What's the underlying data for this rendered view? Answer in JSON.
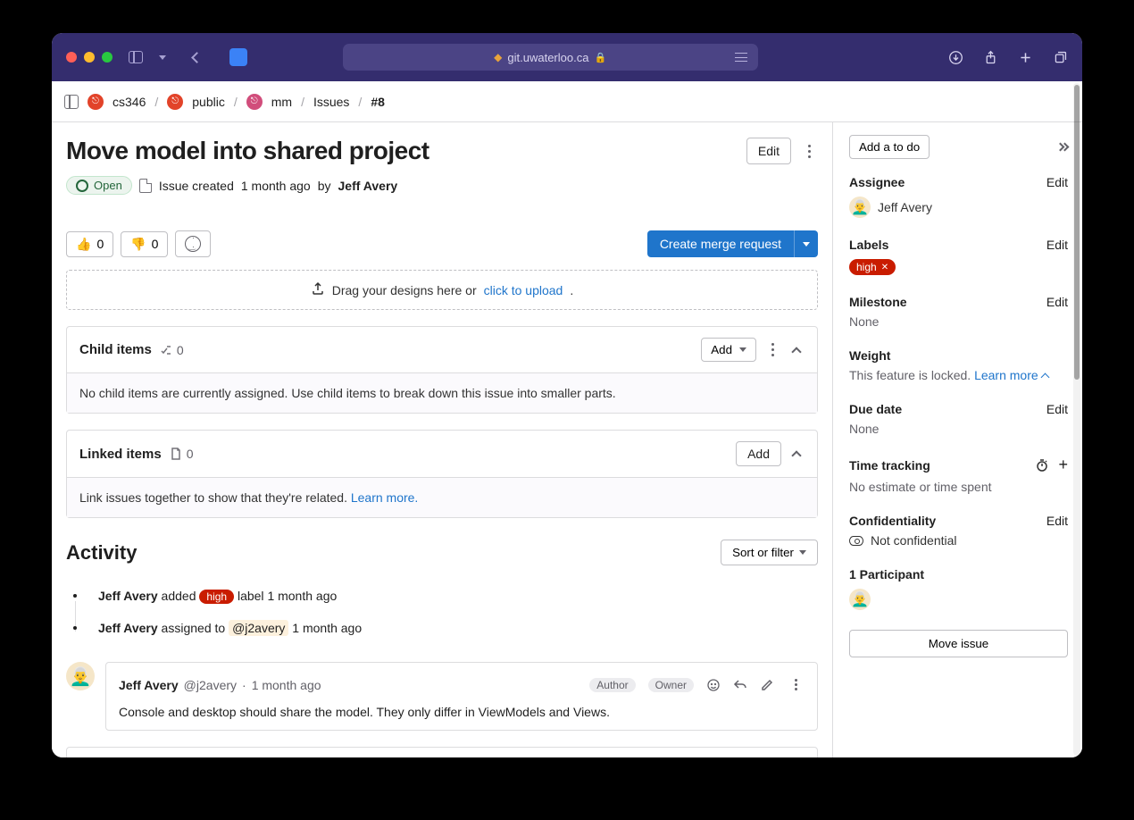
{
  "browser": {
    "url": "git.uwaterloo.ca"
  },
  "breadcrumb": {
    "items": [
      "cs346",
      "public",
      "mm",
      "Issues"
    ],
    "current": "#8"
  },
  "issue": {
    "title": "Move model into shared project",
    "edit_label": "Edit",
    "status": "Open",
    "created_prefix": "Issue created",
    "created_time": "1 month ago",
    "by": "by",
    "author": "Jeff Avery"
  },
  "reactions": {
    "thumbs_up": "0",
    "thumbs_down": "0"
  },
  "merge_request_label": "Create merge request",
  "designs": {
    "text": "Drag your designs here or ",
    "link": "click to upload",
    "suffix": "."
  },
  "child_items": {
    "title": "Child items",
    "count": "0",
    "add_label": "Add",
    "empty": "No child items are currently assigned. Use child items to break down this issue into smaller parts."
  },
  "linked_items": {
    "title": "Linked items",
    "count": "0",
    "add_label": "Add",
    "empty": "Link issues together to show that they're related. ",
    "learn_more": "Learn more."
  },
  "activity": {
    "title": "Activity",
    "sort_label": "Sort or filter",
    "notes": [
      {
        "actor": "Jeff Avery",
        "text_before": " added ",
        "label": "high",
        "text_after": " label ",
        "time": "1 month ago"
      },
      {
        "actor": "Jeff Avery",
        "text_before": " assigned to ",
        "mention": "@j2avery",
        "text_after": " ",
        "time": "1 month ago"
      }
    ],
    "comment": {
      "author": "Jeff Avery",
      "handle": "@j2avery",
      "time": "1 month ago",
      "role1": "Author",
      "role2": "Owner",
      "body": "Console and desktop should share the model. They only differ in ViewModels and Views."
    }
  },
  "sidebar": {
    "todo_label": "Add a to do",
    "assignee": {
      "title": "Assignee",
      "edit": "Edit",
      "name": "Jeff Avery"
    },
    "labels": {
      "title": "Labels",
      "edit": "Edit",
      "value": "high"
    },
    "milestone": {
      "title": "Milestone",
      "edit": "Edit",
      "value": "None"
    },
    "weight": {
      "title": "Weight",
      "locked": "This feature is locked.",
      "learn": "Learn more"
    },
    "due_date": {
      "title": "Due date",
      "edit": "Edit",
      "value": "None"
    },
    "time_tracking": {
      "title": "Time tracking",
      "value": "No estimate or time spent"
    },
    "confidentiality": {
      "title": "Confidentiality",
      "edit": "Edit",
      "value": "Not confidential"
    },
    "participants": {
      "title": "1 Participant"
    },
    "move_label": "Move issue"
  }
}
